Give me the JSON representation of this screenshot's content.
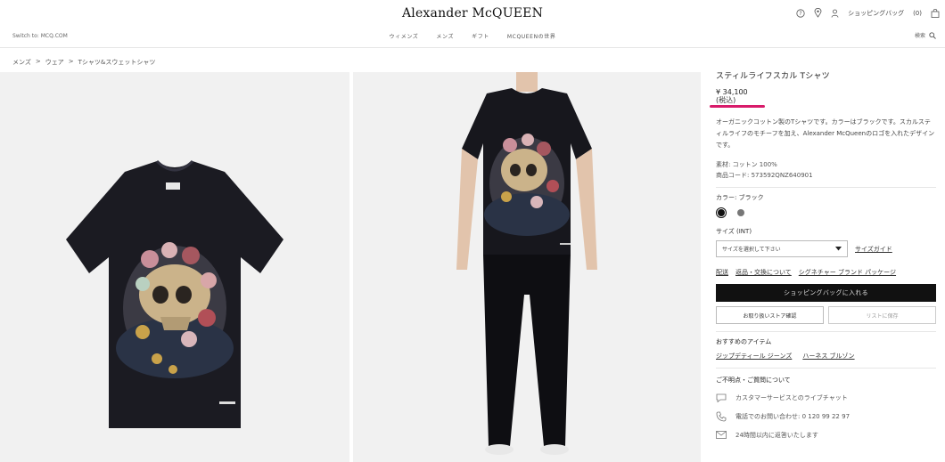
{
  "header": {
    "logo": "Alexander McQUEEN",
    "switch_link": "Switch to: MCQ.COM",
    "nav": [
      "ウィメンズ",
      "メンズ",
      "ギフト",
      "MCQUEENの世界"
    ],
    "search_label": "検索",
    "bag_label": "ショッピングバッグ",
    "bag_count": "(0)",
    "icons": [
      "help-icon",
      "location-pin-icon",
      "user-icon",
      "bag-icon",
      "search-icon"
    ]
  },
  "breadcrumb": [
    "メンズ",
    ">",
    "ウェア",
    ">",
    "Tシャツ&スウェットシャツ"
  ],
  "product": {
    "title": "スティルライフスカル Tシャツ",
    "price": "¥ 34,100",
    "tax_note": "(税込)",
    "description": "オーガニックコットン製のTシャツです。カラーはブラックです。スカルスティルライフのモチーフを加え、Alexander McQueenのロゴを入れたデザインです。",
    "material": "素材: コットン 100%",
    "product_code": "商品コード:  573592QNZ640901",
    "color_label": "カラー: ブラック",
    "size_label": "サイズ  (INT)",
    "size_placeholder": "サイズを選択して下さい",
    "size_guide": "サイズガイド",
    "links": [
      "配送",
      "返品・交換について",
      "シグネチャー ブランド パッケージ"
    ],
    "add_to_bag": "ショッピングバッグに入れる",
    "store_check": "お取り扱いストア確認",
    "save_to_list": "リストに保存",
    "accent_color": "#d81b6a"
  },
  "recommended": {
    "title": "おすすめのアイテム",
    "items": [
      "ジップデティール ジーンズ",
      "ハーネス ブルゾン"
    ]
  },
  "help": {
    "title": "ご不明点・ご質問について",
    "items": [
      {
        "icon": "chat-icon",
        "text": "カスタマーサービスとのライブチャット"
      },
      {
        "icon": "phone-icon",
        "text": "電話でのお問い合わせ: 0 120 99 22 97"
      },
      {
        "icon": "mail-icon",
        "text": "24時間以内に返答いたします"
      }
    ]
  }
}
